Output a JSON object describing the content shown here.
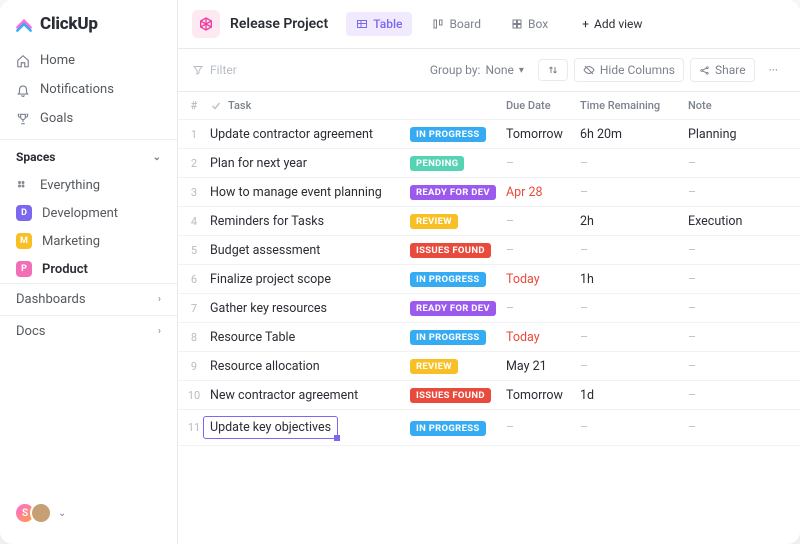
{
  "brand": {
    "name": "ClickUp"
  },
  "nav": {
    "items": [
      {
        "label": "Home",
        "icon": "home-icon"
      },
      {
        "label": "Notifications",
        "icon": "bell-icon"
      },
      {
        "label": "Goals",
        "icon": "trophy-icon"
      }
    ]
  },
  "spaces": {
    "header": "Spaces",
    "everything": {
      "label": "Everything"
    },
    "items": [
      {
        "letter": "D",
        "label": "Development",
        "color": "#7b68ee"
      },
      {
        "letter": "M",
        "label": "Marketing",
        "color": "#f8c024"
      },
      {
        "letter": "P",
        "label": "Product",
        "color": "#f26fb8",
        "active": true
      }
    ]
  },
  "collapsibles": [
    {
      "label": "Dashboards"
    },
    {
      "label": "Docs"
    }
  ],
  "avatars": {
    "initial": "S"
  },
  "header": {
    "project_title": "Release Project",
    "views": [
      {
        "label": "Table",
        "active": true
      },
      {
        "label": "Board"
      },
      {
        "label": "Box"
      }
    ],
    "add_view": "Add view"
  },
  "toolbar": {
    "filter": "Filter",
    "group_by_label": "Group by:",
    "group_by_value": "None",
    "hide_columns": "Hide Columns",
    "share": "Share"
  },
  "table": {
    "columns": {
      "num": "#",
      "task": "Task",
      "due": "Due Date",
      "time": "Time Remaining",
      "note": "Note"
    },
    "rows": [
      {
        "n": "1",
        "task": "Update contractor agreement",
        "status": "IN PROGRESS",
        "status_cls": "inprogress",
        "due": "Tomorrow",
        "due_red": false,
        "time": "6h 20m",
        "note": "Planning"
      },
      {
        "n": "2",
        "task": "Plan for next year",
        "status": "PENDING",
        "status_cls": "pending",
        "due": "–",
        "due_red": false,
        "time": "–",
        "note": "–"
      },
      {
        "n": "3",
        "task": "How to manage event planning",
        "status": "READY FOR DEV",
        "status_cls": "ready",
        "due": "Apr 28",
        "due_red": true,
        "time": "–",
        "note": "–"
      },
      {
        "n": "4",
        "task": "Reminders for Tasks",
        "status": "REVIEW",
        "status_cls": "review",
        "due": "–",
        "due_red": false,
        "time": "2h",
        "note": "Execution"
      },
      {
        "n": "5",
        "task": "Budget assessment",
        "status": "ISSUES FOUND",
        "status_cls": "issues",
        "due": "–",
        "due_red": false,
        "time": "–",
        "note": "–"
      },
      {
        "n": "6",
        "task": "Finalize project scope",
        "status": "IN PROGRESS",
        "status_cls": "inprogress",
        "due": "Today",
        "due_red": true,
        "time": "1h",
        "note": "–"
      },
      {
        "n": "7",
        "task": "Gather key resources",
        "status": "READY FOR DEV",
        "status_cls": "ready",
        "due": "–",
        "due_red": false,
        "time": "–",
        "note": "–"
      },
      {
        "n": "8",
        "task": "Resource Table",
        "status": "IN PROGRESS",
        "status_cls": "inprogress",
        "due": "Today",
        "due_red": true,
        "time": "–",
        "note": "–"
      },
      {
        "n": "9",
        "task": "Resource allocation",
        "status": "REVIEW",
        "status_cls": "review",
        "due": "May 21",
        "due_red": false,
        "time": "–",
        "note": "–"
      },
      {
        "n": "10",
        "task": "New contractor agreement",
        "status": "ISSUES FOUND",
        "status_cls": "issues",
        "due": "Tomorrow",
        "due_red": false,
        "time": "1d",
        "note": "–"
      },
      {
        "n": "11",
        "task": "Update key objectives",
        "status": "IN PROGRESS",
        "status_cls": "inprogress",
        "due": "–",
        "due_red": false,
        "time": "–",
        "note": "–",
        "editing": true
      }
    ]
  }
}
